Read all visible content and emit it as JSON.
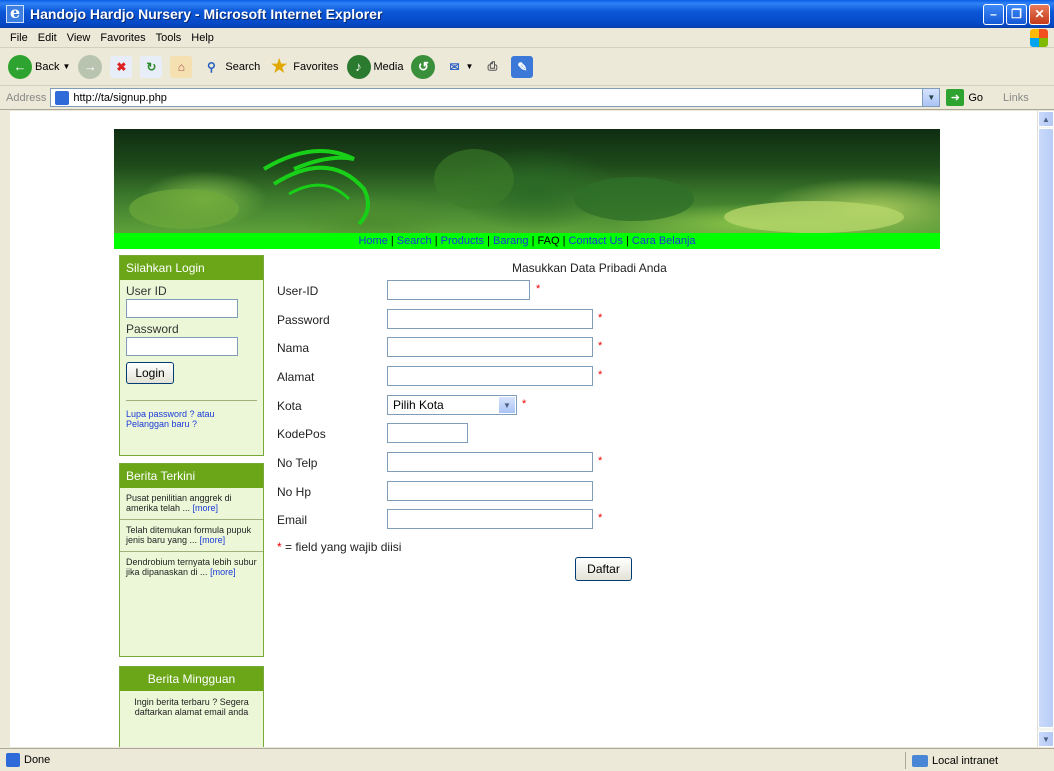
{
  "window": {
    "title": "Handojo Hardjo Nursery - Microsoft Internet Explorer"
  },
  "menu": [
    "File",
    "Edit",
    "View",
    "Favorites",
    "Tools",
    "Help"
  ],
  "toolbar": {
    "back": "Back",
    "search": "Search",
    "favorites": "Favorites",
    "media": "Media"
  },
  "address": {
    "label": "Address",
    "url": "http://ta/signup.php",
    "go": "Go",
    "links": "Links"
  },
  "nav": {
    "home": "Home",
    "search": "Search",
    "products": "Products",
    "barang": "Barang",
    "faq": "FAQ",
    "contact": "Contact Us",
    "cara": "Cara Belanja",
    "sep": " | "
  },
  "login": {
    "header": "Silahkan Login",
    "userid_label": "User ID",
    "password_label": "Password",
    "button": "Login",
    "forgot": "Lupa password ? atau",
    "new_customer": "Pelanggan baru ?"
  },
  "news": {
    "header": "Berita Terkini",
    "more": "[more]",
    "items": [
      "Pusat penilitian anggrek di amerika telah ...",
      "Telah ditemukan formula pupuk jenis baru yang ...",
      "Dendrobium ternyata lebih subur jika dipanaskan di ..."
    ]
  },
  "weekly": {
    "header": "Berita Mingguan",
    "text": "Ingin berita terbaru ? Segera daftarkan alamat email anda"
  },
  "form": {
    "title": "Masukkan Data Pribadi Anda",
    "fields": {
      "userid": "User-ID",
      "password": "Password",
      "nama": "Nama",
      "alamat": "Alamat",
      "kota": "Kota",
      "kodepos": "KodePos",
      "notelp": "No Telp",
      "nohp": "No Hp",
      "email": "Email"
    },
    "kota_selected": "Pilih Kota",
    "required_mark": "*",
    "note": " = field yang wajib diisi",
    "submit": "Daftar"
  },
  "status": {
    "left": "Done",
    "zone": "Local intranet"
  }
}
